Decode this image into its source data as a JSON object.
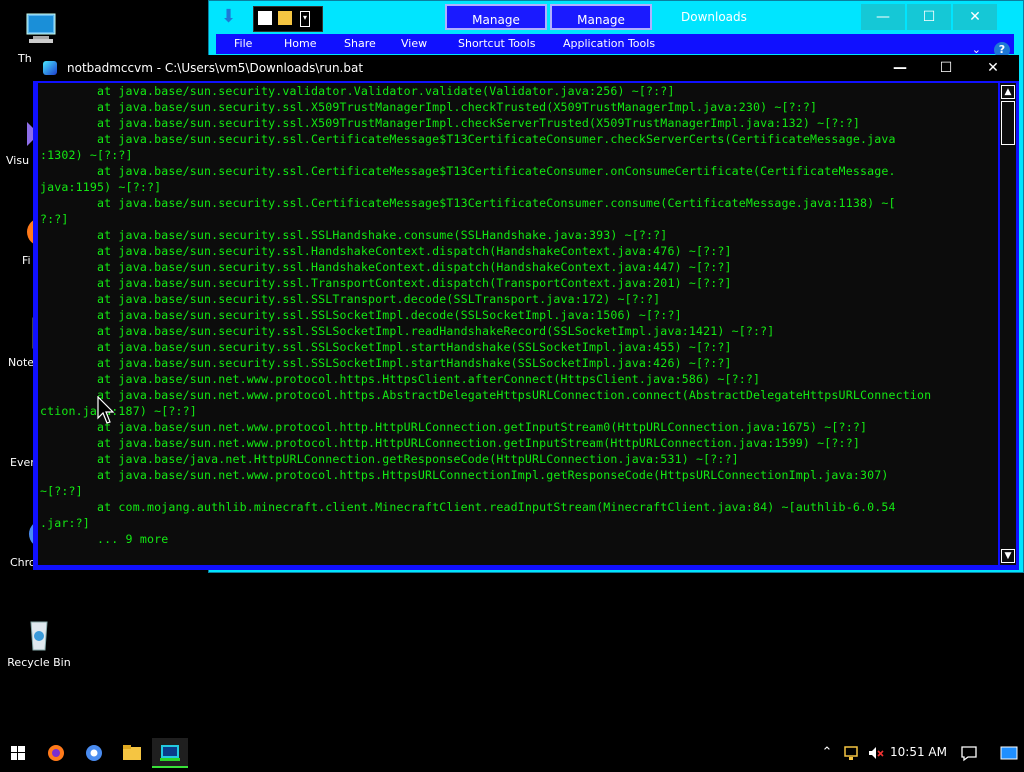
{
  "desktop": {
    "icons": [
      {
        "label": "Th",
        "icon": "this-pc-icon"
      },
      {
        "label": "Visu",
        "icon": "visual-studio-icon"
      },
      {
        "label": "Fi",
        "icon": "firefox-icon"
      },
      {
        "label": "Note",
        "icon": "notepad-icon"
      },
      {
        "label": "Ever",
        "icon": "everything-icon"
      },
      {
        "label": "Chromium",
        "icon": "chromium-icon"
      },
      {
        "label": "Recycle Bin",
        "icon": "recycle-bin-icon"
      }
    ]
  },
  "explorer": {
    "title": "Downloads",
    "manage_tabs": [
      "Manage",
      "Manage"
    ],
    "ribbon_tabs": [
      "File",
      "Home",
      "Share",
      "View",
      "Shortcut Tools",
      "Application Tools"
    ],
    "controls": {
      "minimize": "—",
      "maximize": "☐",
      "close": "✕"
    }
  },
  "console": {
    "title": "notbadmccvm - C:\\Users\\vm5\\Downloads\\run.bat",
    "controls": {
      "minimize": "—",
      "maximize": "☐",
      "close": "✕"
    },
    "lines": [
      "        at java.base/sun.security.validator.Validator.validate(Validator.java:256) ~[?:?]",
      "        at java.base/sun.security.ssl.X509TrustManagerImpl.checkTrusted(X509TrustManagerImpl.java:230) ~[?:?]",
      "        at java.base/sun.security.ssl.X509TrustManagerImpl.checkServerTrusted(X509TrustManagerImpl.java:132) ~[?:?]",
      "        at java.base/sun.security.ssl.CertificateMessage$T13CertificateConsumer.checkServerCerts(CertificateMessage.java",
      ":1302) ~[?:?]",
      "        at java.base/sun.security.ssl.CertificateMessage$T13CertificateConsumer.onConsumeCertificate(CertificateMessage.",
      "java:1195) ~[?:?]",
      "        at java.base/sun.security.ssl.CertificateMessage$T13CertificateConsumer.consume(CertificateMessage.java:1138) ~[",
      "?:?]",
      "        at java.base/sun.security.ssl.SSLHandshake.consume(SSLHandshake.java:393) ~[?:?]",
      "        at java.base/sun.security.ssl.HandshakeContext.dispatch(HandshakeContext.java:476) ~[?:?]",
      "        at java.base/sun.security.ssl.HandshakeContext.dispatch(HandshakeContext.java:447) ~[?:?]",
      "        at java.base/sun.security.ssl.TransportContext.dispatch(TransportContext.java:201) ~[?:?]",
      "        at java.base/sun.security.ssl.SSLTransport.decode(SSLTransport.java:172) ~[?:?]",
      "        at java.base/sun.security.ssl.SSLSocketImpl.decode(SSLSocketImpl.java:1506) ~[?:?]",
      "        at java.base/sun.security.ssl.SSLSocketImpl.readHandshakeRecord(SSLSocketImpl.java:1421) ~[?:?]",
      "        at java.base/sun.security.ssl.SSLSocketImpl.startHandshake(SSLSocketImpl.java:455) ~[?:?]",
      "        at java.base/sun.security.ssl.SSLSocketImpl.startHandshake(SSLSocketImpl.java:426) ~[?:?]",
      "        at java.base/sun.net.www.protocol.https.HttpsClient.afterConnect(HttpsClient.java:586) ~[?:?]",
      "        at java.base/sun.net.www.protocol.https.AbstractDelegateHttpsURLConnection.connect(AbstractDelegateHttpsURLConnection",
      "ction.java:187) ~[?:?]",
      "        at java.base/sun.net.www.protocol.http.HttpURLConnection.getInputStream0(HttpURLConnection.java:1675) ~[?:?]",
      "        at java.base/sun.net.www.protocol.http.HttpURLConnection.getInputStream(HttpURLConnection.java:1599) ~[?:?]",
      "        at java.base/java.net.HttpURLConnection.getResponseCode(HttpURLConnection.java:531) ~[?:?]",
      "        at java.base/sun.net.www.protocol.https.HttpsURLConnectionImpl.getResponseCode(HttpsURLConnectionImpl.java:307)",
      "~[?:?]",
      "        at com.mojang.authlib.minecraft.client.MinecraftClient.readInputStream(MinecraftClient.java:84) ~[authlib-6.0.54",
      ".jar:?]",
      "        ... 9 more"
    ],
    "text_color": "#13e813",
    "bg_color": "#0c0c0c",
    "frame_color": "#1010ff"
  },
  "taskbar": {
    "apps": [
      "start-icon",
      "firefox-icon",
      "chrome-icon",
      "file-explorer-icon",
      "cmd-icon"
    ],
    "clock": "10:51 AM"
  }
}
